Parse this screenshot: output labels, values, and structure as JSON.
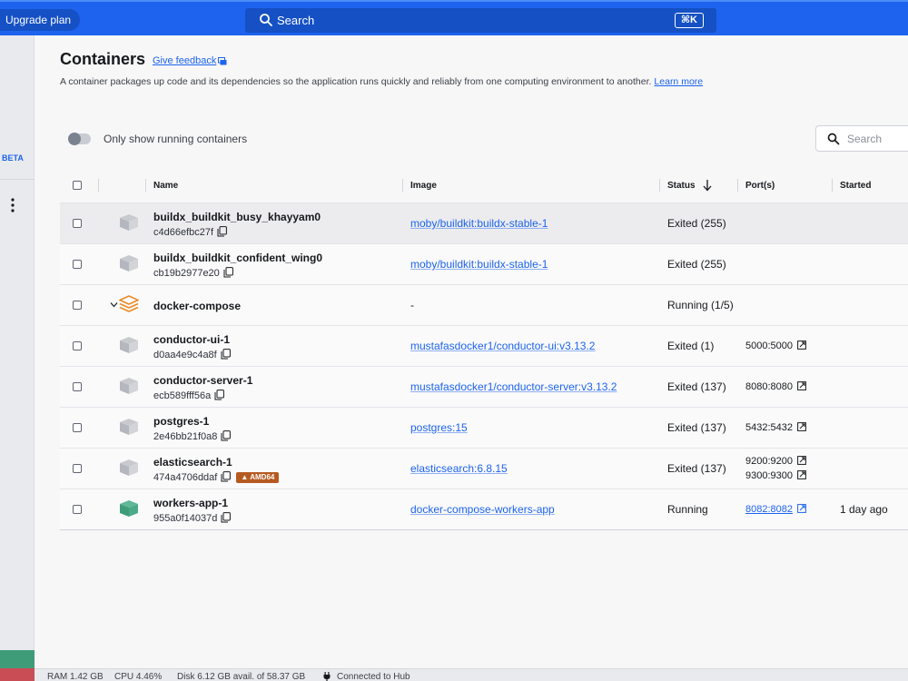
{
  "topbar": {
    "upgrade_label": "Upgrade plan",
    "search_label": "Search",
    "search_shortcut": "⌘K"
  },
  "sidebar": {
    "beta_label": "BETA"
  },
  "page": {
    "title": "Containers",
    "feedback_label": "Give feedback",
    "description": "A container packages up code and its dependencies so the application runs quickly and reliably from one computing environment to another.",
    "learn_more": "Learn more",
    "toggle_label": "Only show running containers",
    "search_placeholder": "Search"
  },
  "table": {
    "headers": {
      "name": "Name",
      "image": "Image",
      "status": "Status",
      "ports": "Port(s)",
      "started": "Started"
    },
    "rows": [
      {
        "name": "buildx_buildkit_busy_khayyam0",
        "id": "c4d66efbc27f",
        "image": "moby/buildkit:buildx-stable-1",
        "status": "Exited (255)"
      },
      {
        "name": "buildx_buildkit_confident_wing0",
        "id": "cb19b2977e20",
        "image": "moby/buildkit:buildx-stable-1",
        "status": "Exited (255)"
      },
      {
        "name": "docker-compose",
        "image": "-",
        "status": "Running (1/5)"
      },
      {
        "name": "conductor-ui-1",
        "id": "d0aa4e9c4a8f",
        "image": "mustafasdocker1/conductor-ui:v3.13.2",
        "status": "Exited (1)",
        "ports": [
          "5000:5000"
        ]
      },
      {
        "name": "conductor-server-1",
        "id": "ecb589fff56a",
        "image": "mustafasdocker1/conductor-server:v3.13.2",
        "status": "Exited (137)",
        "ports": [
          "8080:8080"
        ]
      },
      {
        "name": "postgres-1",
        "id": "2e46bb21f0a8",
        "image": "postgres:15",
        "status": "Exited (137)",
        "ports": [
          "5432:5432"
        ]
      },
      {
        "name": "elasticsearch-1",
        "id": "474a4706ddaf",
        "badge": "AMD64",
        "image": "elasticsearch:6.8.15",
        "status": "Exited (137)",
        "ports": [
          "9200:9200",
          "9300:9300"
        ]
      },
      {
        "name": "workers-app-1",
        "id": "955a0f14037d",
        "image": "docker-compose-workers-app",
        "status": "Running",
        "ports": [
          "8082:8082"
        ],
        "started": "1 day ago"
      }
    ]
  },
  "bottombar": {
    "ram": "RAM 1.42 GB",
    "cpu": "CPU 4.46%",
    "disk": "Disk 6.12 GB avail. of 58.37 GB",
    "hub": "Connected to Hub"
  },
  "colors": {
    "accent": "#1d63ed",
    "running_container": "#3f9c78",
    "compose_stack": "#e98b26",
    "amd64_badge": "#b65a22"
  }
}
